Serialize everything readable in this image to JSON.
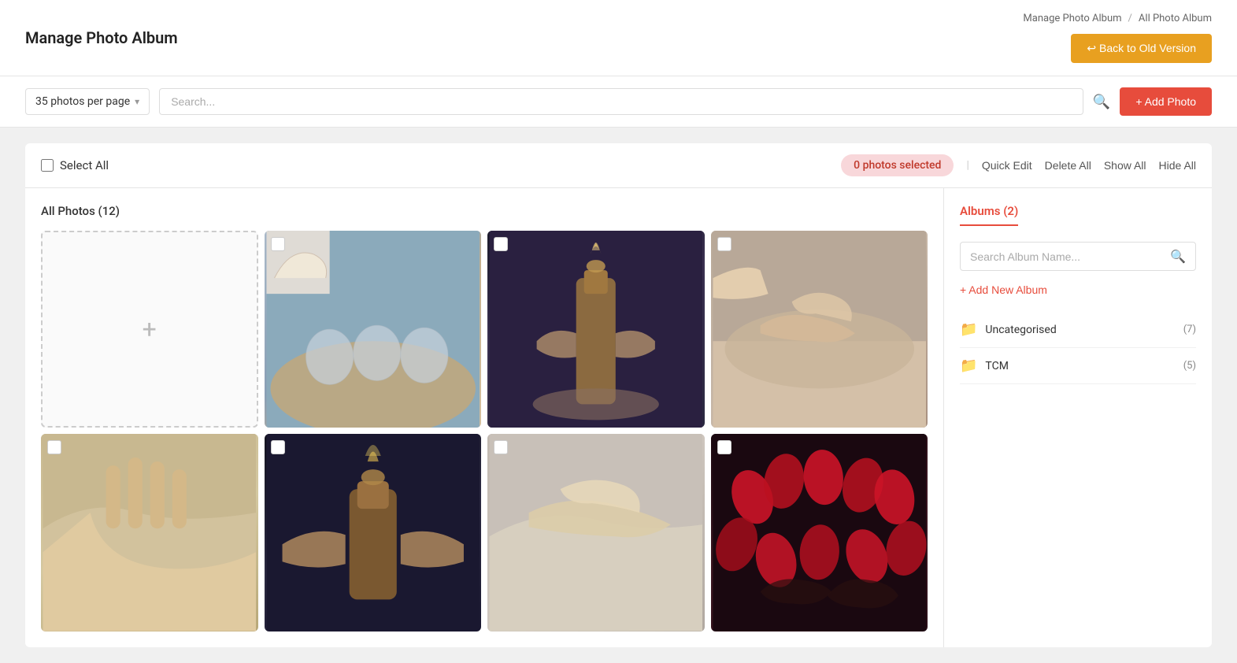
{
  "header": {
    "title": "Manage Photo Album",
    "breadcrumb": {
      "parent": "Manage Photo Album",
      "separator": "/",
      "current": "All Photo Album"
    },
    "back_btn_label": "↩ Back to Old Version"
  },
  "toolbar": {
    "per_page_label": "35 photos per page",
    "search_placeholder": "Search...",
    "add_photo_label": "+ Add Photo"
  },
  "selection": {
    "select_all_label": "Select All",
    "photos_selected_label": "0 photos selected",
    "quick_edit_label": "Quick Edit",
    "delete_all_label": "Delete All",
    "show_all_label": "Show All",
    "hide_all_label": "Hide All"
  },
  "photos_section": {
    "title": "All Photos (12)"
  },
  "albums_sidebar": {
    "title": "Albums (2)",
    "search_placeholder": "Search Album Name...",
    "add_album_label": "+ Add New Album",
    "albums": [
      {
        "name": "Uncategorised",
        "count": "(7)"
      },
      {
        "name": "TCM",
        "count": "(5)"
      }
    ]
  },
  "photos": [
    {
      "id": 1,
      "type": "upload",
      "label": "upload"
    },
    {
      "id": 2,
      "type": "image",
      "bg": "bg1"
    },
    {
      "id": 3,
      "type": "image",
      "bg": "bg2"
    },
    {
      "id": 4,
      "type": "image",
      "bg": "bg3"
    },
    {
      "id": 5,
      "type": "image",
      "bg": "bg4"
    },
    {
      "id": 6,
      "type": "image",
      "bg": "bg5"
    },
    {
      "id": 7,
      "type": "image",
      "bg": "bg6"
    },
    {
      "id": 8,
      "type": "image",
      "bg": "bg7"
    }
  ]
}
